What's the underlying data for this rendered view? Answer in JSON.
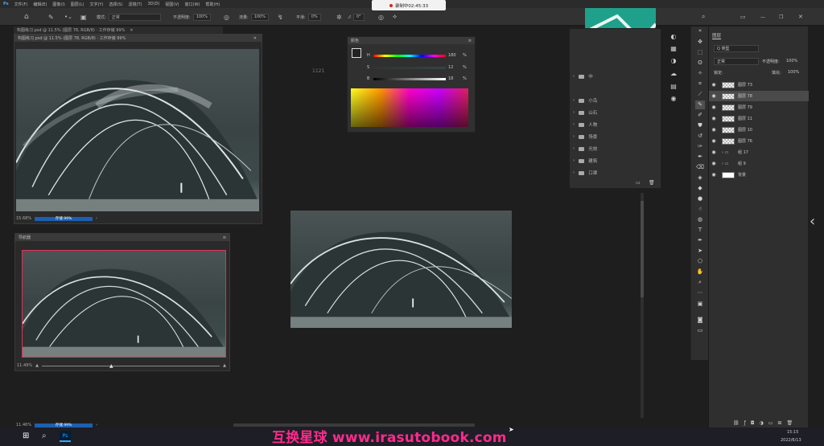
{
  "menubar": {
    "items": [
      "文件(F)",
      "编辑(E)",
      "图像(I)",
      "图层(L)",
      "文字(Y)",
      "选择(S)",
      "滤镜(T)",
      "3D(D)",
      "视图(V)",
      "窗口(W)",
      "帮助(H)"
    ]
  },
  "options": {
    "mode_label": "模式:",
    "mode_value": "正常",
    "opacity_label": "不透明度:",
    "opacity_value": "100%",
    "flow_label": "流量:",
    "flow_value": "100%",
    "smooth_label": "平滑:",
    "smooth_value": "0%",
    "angle_value": "0°"
  },
  "recording": {
    "text": "录制中02:45:33"
  },
  "doc_tab": {
    "title": "构图练习.psd @ 11.5% (图层 78, RGB/8) · 工作存储 99%"
  },
  "doc_window": {
    "title": "构图练习.psd @ 11.5% (图层 78, RGB/8) · 工作存储 99%",
    "zoom": "15.68%",
    "status": "存储 99%"
  },
  "navigator": {
    "title": "导航器",
    "zoom": "11.49%"
  },
  "main_status": {
    "zoom": "11.46%",
    "status": "存储 99%"
  },
  "canvas_label": "1121",
  "color_panel": {
    "title": "颜色",
    "h_label": "H",
    "h_value": "180",
    "s_label": "S",
    "s_value": "12",
    "b_label": "B",
    "b_value": "18",
    "pct": "%"
  },
  "folders": {
    "items": [
      "中",
      "小鸟",
      "山石",
      "人物",
      "场景",
      "光效",
      "建筑",
      "口罩"
    ]
  },
  "layers_panel": {
    "title": "图层",
    "filter": "Q 类型",
    "blend": "正常",
    "opacity_label": "不透明度:",
    "opacity_value": "100%",
    "lock_label": "锁定:",
    "fill_label": "填充:",
    "fill_value": "100%",
    "items": [
      {
        "name": "图层 73",
        "thumb": "checker",
        "selected": false
      },
      {
        "name": "图层 78",
        "thumb": "checker",
        "selected": true
      },
      {
        "name": "图层 79",
        "thumb": "checker",
        "selected": false
      },
      {
        "name": "图层 11",
        "thumb": "checker",
        "selected": false
      },
      {
        "name": "图层 10",
        "thumb": "checker",
        "selected": false
      },
      {
        "name": "图层 76",
        "thumb": "checker",
        "selected": false
      },
      {
        "name": "组 17",
        "thumb": "folder",
        "selected": false
      },
      {
        "name": "组 9",
        "thumb": "folder",
        "selected": false
      },
      {
        "name": "背景",
        "thumb": "white",
        "selected": false
      }
    ]
  },
  "taskbar": {
    "time": "15:15",
    "date": "2022/6/13"
  },
  "watermark": "互换星球 www.irasutobook.com",
  "colors": {
    "accent": "#1d5fb0",
    "record": "#e02020",
    "watermark": "#ff2a8c",
    "nav_frame": "#e0305a",
    "teal": "#1fa08a"
  }
}
